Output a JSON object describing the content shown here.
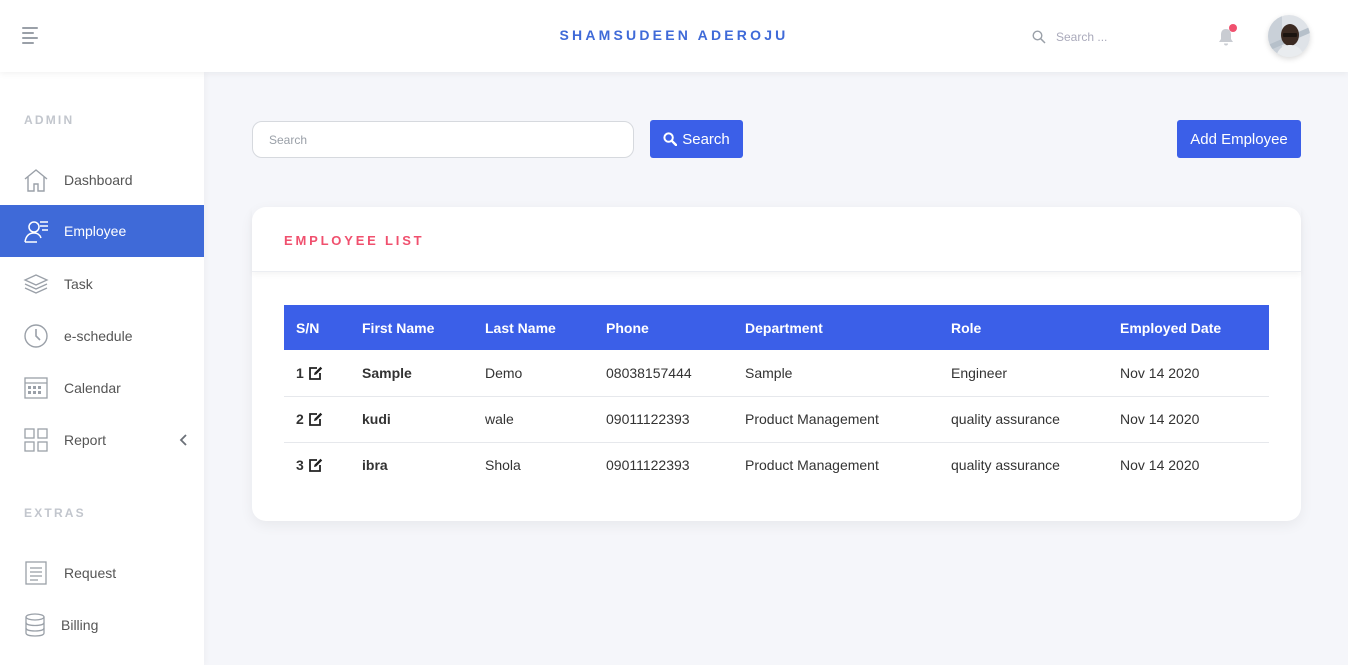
{
  "header": {
    "brand": "SHAMSUDEEN ADEROJU",
    "search_placeholder": "Search ..."
  },
  "sidebar": {
    "admin_heading": "ADMIN",
    "extras_heading": "EXTRAS",
    "items": [
      {
        "label": "Dashboard",
        "icon": "home-icon"
      },
      {
        "label": "Employee",
        "icon": "employee-icon",
        "active": true
      },
      {
        "label": "Task",
        "icon": "layers-icon"
      },
      {
        "label": "e-schedule",
        "icon": "clock-icon"
      },
      {
        "label": "Calendar",
        "icon": "calendar-icon"
      },
      {
        "label": "Report",
        "icon": "grid-icon"
      }
    ],
    "extras": [
      {
        "label": "Request",
        "icon": "document-icon"
      },
      {
        "label": "Billing",
        "icon": "database-icon"
      }
    ]
  },
  "toolbar": {
    "search_placeholder": "Search",
    "search_label": "Search",
    "add_label": "Add Employee"
  },
  "employee_card": {
    "title": "EMPLOYEE LIST",
    "columns": [
      "S/N",
      "First Name",
      "Last Name",
      "Phone",
      "Department",
      "Role",
      "Employed Date"
    ],
    "rows": [
      {
        "sn": "1",
        "first": "Sample",
        "last": "Demo",
        "phone": "08038157444",
        "department": "Sample",
        "role": "Engineer",
        "date": "Nov 14 2020"
      },
      {
        "sn": "2",
        "first": "kudi",
        "last": "wale",
        "phone": "09011122393",
        "department": "Product Management",
        "role": "quality assurance",
        "date": "Nov 14 2020"
      },
      {
        "sn": "3",
        "first": "ibra",
        "last": "Shola",
        "phone": "09011122393",
        "department": "Product Management",
        "role": "quality assurance",
        "date": "Nov 14 2020"
      }
    ]
  },
  "colors": {
    "primary": "#3b5fe8",
    "brand": "#3f6ad8",
    "accent": "#f0506e"
  }
}
